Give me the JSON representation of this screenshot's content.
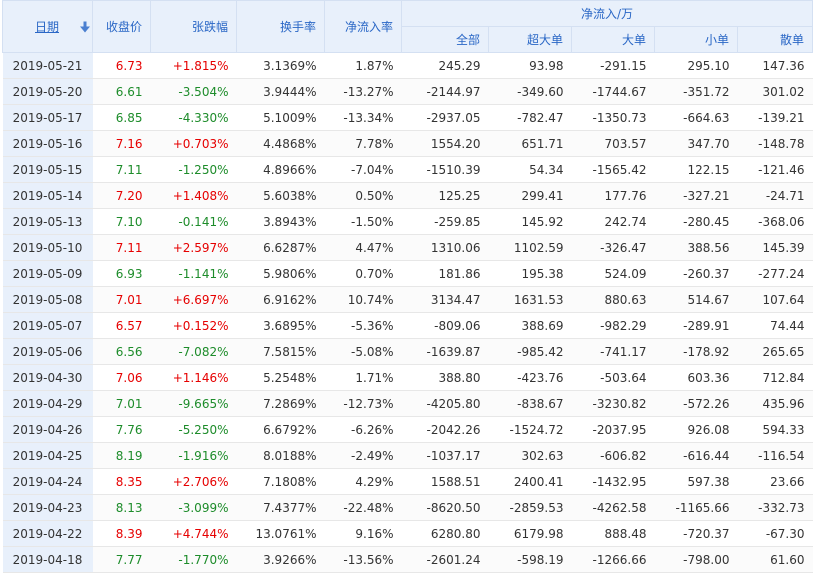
{
  "header": {
    "date": "日期",
    "close": "收盘价",
    "change_pct": "张跌幅",
    "turnover": "换手率",
    "net_inflow_rate": "净流入率",
    "net_inflow_group": "净流入/万",
    "all": "全部",
    "xlarge": "超大单",
    "large": "大单",
    "small": "小单",
    "retail": "散单"
  },
  "colors": {
    "up": "#e60000",
    "down": "#1d8c2a",
    "header_bg": "#e8f0fb",
    "header_text": "#2a67c6"
  },
  "rows": [
    {
      "date": "2019-05-21",
      "close": "6.73",
      "change": "+1.815%",
      "turnover": "3.1369%",
      "rate": "1.87%",
      "all": "245.29",
      "xlarge": "93.98",
      "large": "-291.15",
      "small": "295.10",
      "retail": "147.36",
      "dir": "up"
    },
    {
      "date": "2019-05-20",
      "close": "6.61",
      "change": "-3.504%",
      "turnover": "3.9444%",
      "rate": "-13.27%",
      "all": "-2144.97",
      "xlarge": "-349.60",
      "large": "-1744.67",
      "small": "-351.72",
      "retail": "301.02",
      "dir": "down"
    },
    {
      "date": "2019-05-17",
      "close": "6.85",
      "change": "-4.330%",
      "turnover": "5.1009%",
      "rate": "-13.34%",
      "all": "-2937.05",
      "xlarge": "-782.47",
      "large": "-1350.73",
      "small": "-664.63",
      "retail": "-139.21",
      "dir": "down"
    },
    {
      "date": "2019-05-16",
      "close": "7.16",
      "change": "+0.703%",
      "turnover": "4.4868%",
      "rate": "7.78%",
      "all": "1554.20",
      "xlarge": "651.71",
      "large": "703.57",
      "small": "347.70",
      "retail": "-148.78",
      "dir": "up"
    },
    {
      "date": "2019-05-15",
      "close": "7.11",
      "change": "-1.250%",
      "turnover": "4.8966%",
      "rate": "-7.04%",
      "all": "-1510.39",
      "xlarge": "54.34",
      "large": "-1565.42",
      "small": "122.15",
      "retail": "-121.46",
      "dir": "down"
    },
    {
      "date": "2019-05-14",
      "close": "7.20",
      "change": "+1.408%",
      "turnover": "5.6038%",
      "rate": "0.50%",
      "all": "125.25",
      "xlarge": "299.41",
      "large": "177.76",
      "small": "-327.21",
      "retail": "-24.71",
      "dir": "up"
    },
    {
      "date": "2019-05-13",
      "close": "7.10",
      "change": "-0.141%",
      "turnover": "3.8943%",
      "rate": "-1.50%",
      "all": "-259.85",
      "xlarge": "145.92",
      "large": "242.74",
      "small": "-280.45",
      "retail": "-368.06",
      "dir": "down"
    },
    {
      "date": "2019-05-10",
      "close": "7.11",
      "change": "+2.597%",
      "turnover": "6.6287%",
      "rate": "4.47%",
      "all": "1310.06",
      "xlarge": "1102.59",
      "large": "-326.47",
      "small": "388.56",
      "retail": "145.39",
      "dir": "up"
    },
    {
      "date": "2019-05-09",
      "close": "6.93",
      "change": "-1.141%",
      "turnover": "5.9806%",
      "rate": "0.70%",
      "all": "181.86",
      "xlarge": "195.38",
      "large": "524.09",
      "small": "-260.37",
      "retail": "-277.24",
      "dir": "down"
    },
    {
      "date": "2019-05-08",
      "close": "7.01",
      "change": "+6.697%",
      "turnover": "6.9162%",
      "rate": "10.74%",
      "all": "3134.47",
      "xlarge": "1631.53",
      "large": "880.63",
      "small": "514.67",
      "retail": "107.64",
      "dir": "up"
    },
    {
      "date": "2019-05-07",
      "close": "6.57",
      "change": "+0.152%",
      "turnover": "3.6895%",
      "rate": "-5.36%",
      "all": "-809.06",
      "xlarge": "388.69",
      "large": "-982.29",
      "small": "-289.91",
      "retail": "74.44",
      "dir": "up"
    },
    {
      "date": "2019-05-06",
      "close": "6.56",
      "change": "-7.082%",
      "turnover": "7.5815%",
      "rate": "-5.08%",
      "all": "-1639.87",
      "xlarge": "-985.42",
      "large": "-741.17",
      "small": "-178.92",
      "retail": "265.65",
      "dir": "down"
    },
    {
      "date": "2019-04-30",
      "close": "7.06",
      "change": "+1.146%",
      "turnover": "5.2548%",
      "rate": "1.71%",
      "all": "388.80",
      "xlarge": "-423.76",
      "large": "-503.64",
      "small": "603.36",
      "retail": "712.84",
      "dir": "up"
    },
    {
      "date": "2019-04-29",
      "close": "7.01",
      "change": "-9.665%",
      "turnover": "7.2869%",
      "rate": "-12.73%",
      "all": "-4205.80",
      "xlarge": "-838.67",
      "large": "-3230.82",
      "small": "-572.26",
      "retail": "435.96",
      "dir": "down"
    },
    {
      "date": "2019-04-26",
      "close": "7.76",
      "change": "-5.250%",
      "turnover": "6.6792%",
      "rate": "-6.26%",
      "all": "-2042.26",
      "xlarge": "-1524.72",
      "large": "-2037.95",
      "small": "926.08",
      "retail": "594.33",
      "dir": "down"
    },
    {
      "date": "2019-04-25",
      "close": "8.19",
      "change": "-1.916%",
      "turnover": "8.0188%",
      "rate": "-2.49%",
      "all": "-1037.17",
      "xlarge": "302.63",
      "large": "-606.82",
      "small": "-616.44",
      "retail": "-116.54",
      "dir": "down"
    },
    {
      "date": "2019-04-24",
      "close": "8.35",
      "change": "+2.706%",
      "turnover": "7.1808%",
      "rate": "4.29%",
      "all": "1588.51",
      "xlarge": "2400.41",
      "large": "-1432.95",
      "small": "597.38",
      "retail": "23.66",
      "dir": "up"
    },
    {
      "date": "2019-04-23",
      "close": "8.13",
      "change": "-3.099%",
      "turnover": "7.4377%",
      "rate": "-22.48%",
      "all": "-8620.50",
      "xlarge": "-2859.53",
      "large": "-4262.58",
      "small": "-1165.66",
      "retail": "-332.73",
      "dir": "down"
    },
    {
      "date": "2019-04-22",
      "close": "8.39",
      "change": "+4.744%",
      "turnover": "13.0761%",
      "rate": "9.16%",
      "all": "6280.80",
      "xlarge": "6179.98",
      "large": "888.48",
      "small": "-720.37",
      "retail": "-67.30",
      "dir": "up"
    },
    {
      "date": "2019-04-18",
      "close": "7.77",
      "change": "-1.770%",
      "turnover": "3.9266%",
      "rate": "-13.56%",
      "all": "-2601.24",
      "xlarge": "-598.19",
      "large": "-1266.66",
      "small": "-798.00",
      "retail": "61.60",
      "dir": "down"
    }
  ]
}
